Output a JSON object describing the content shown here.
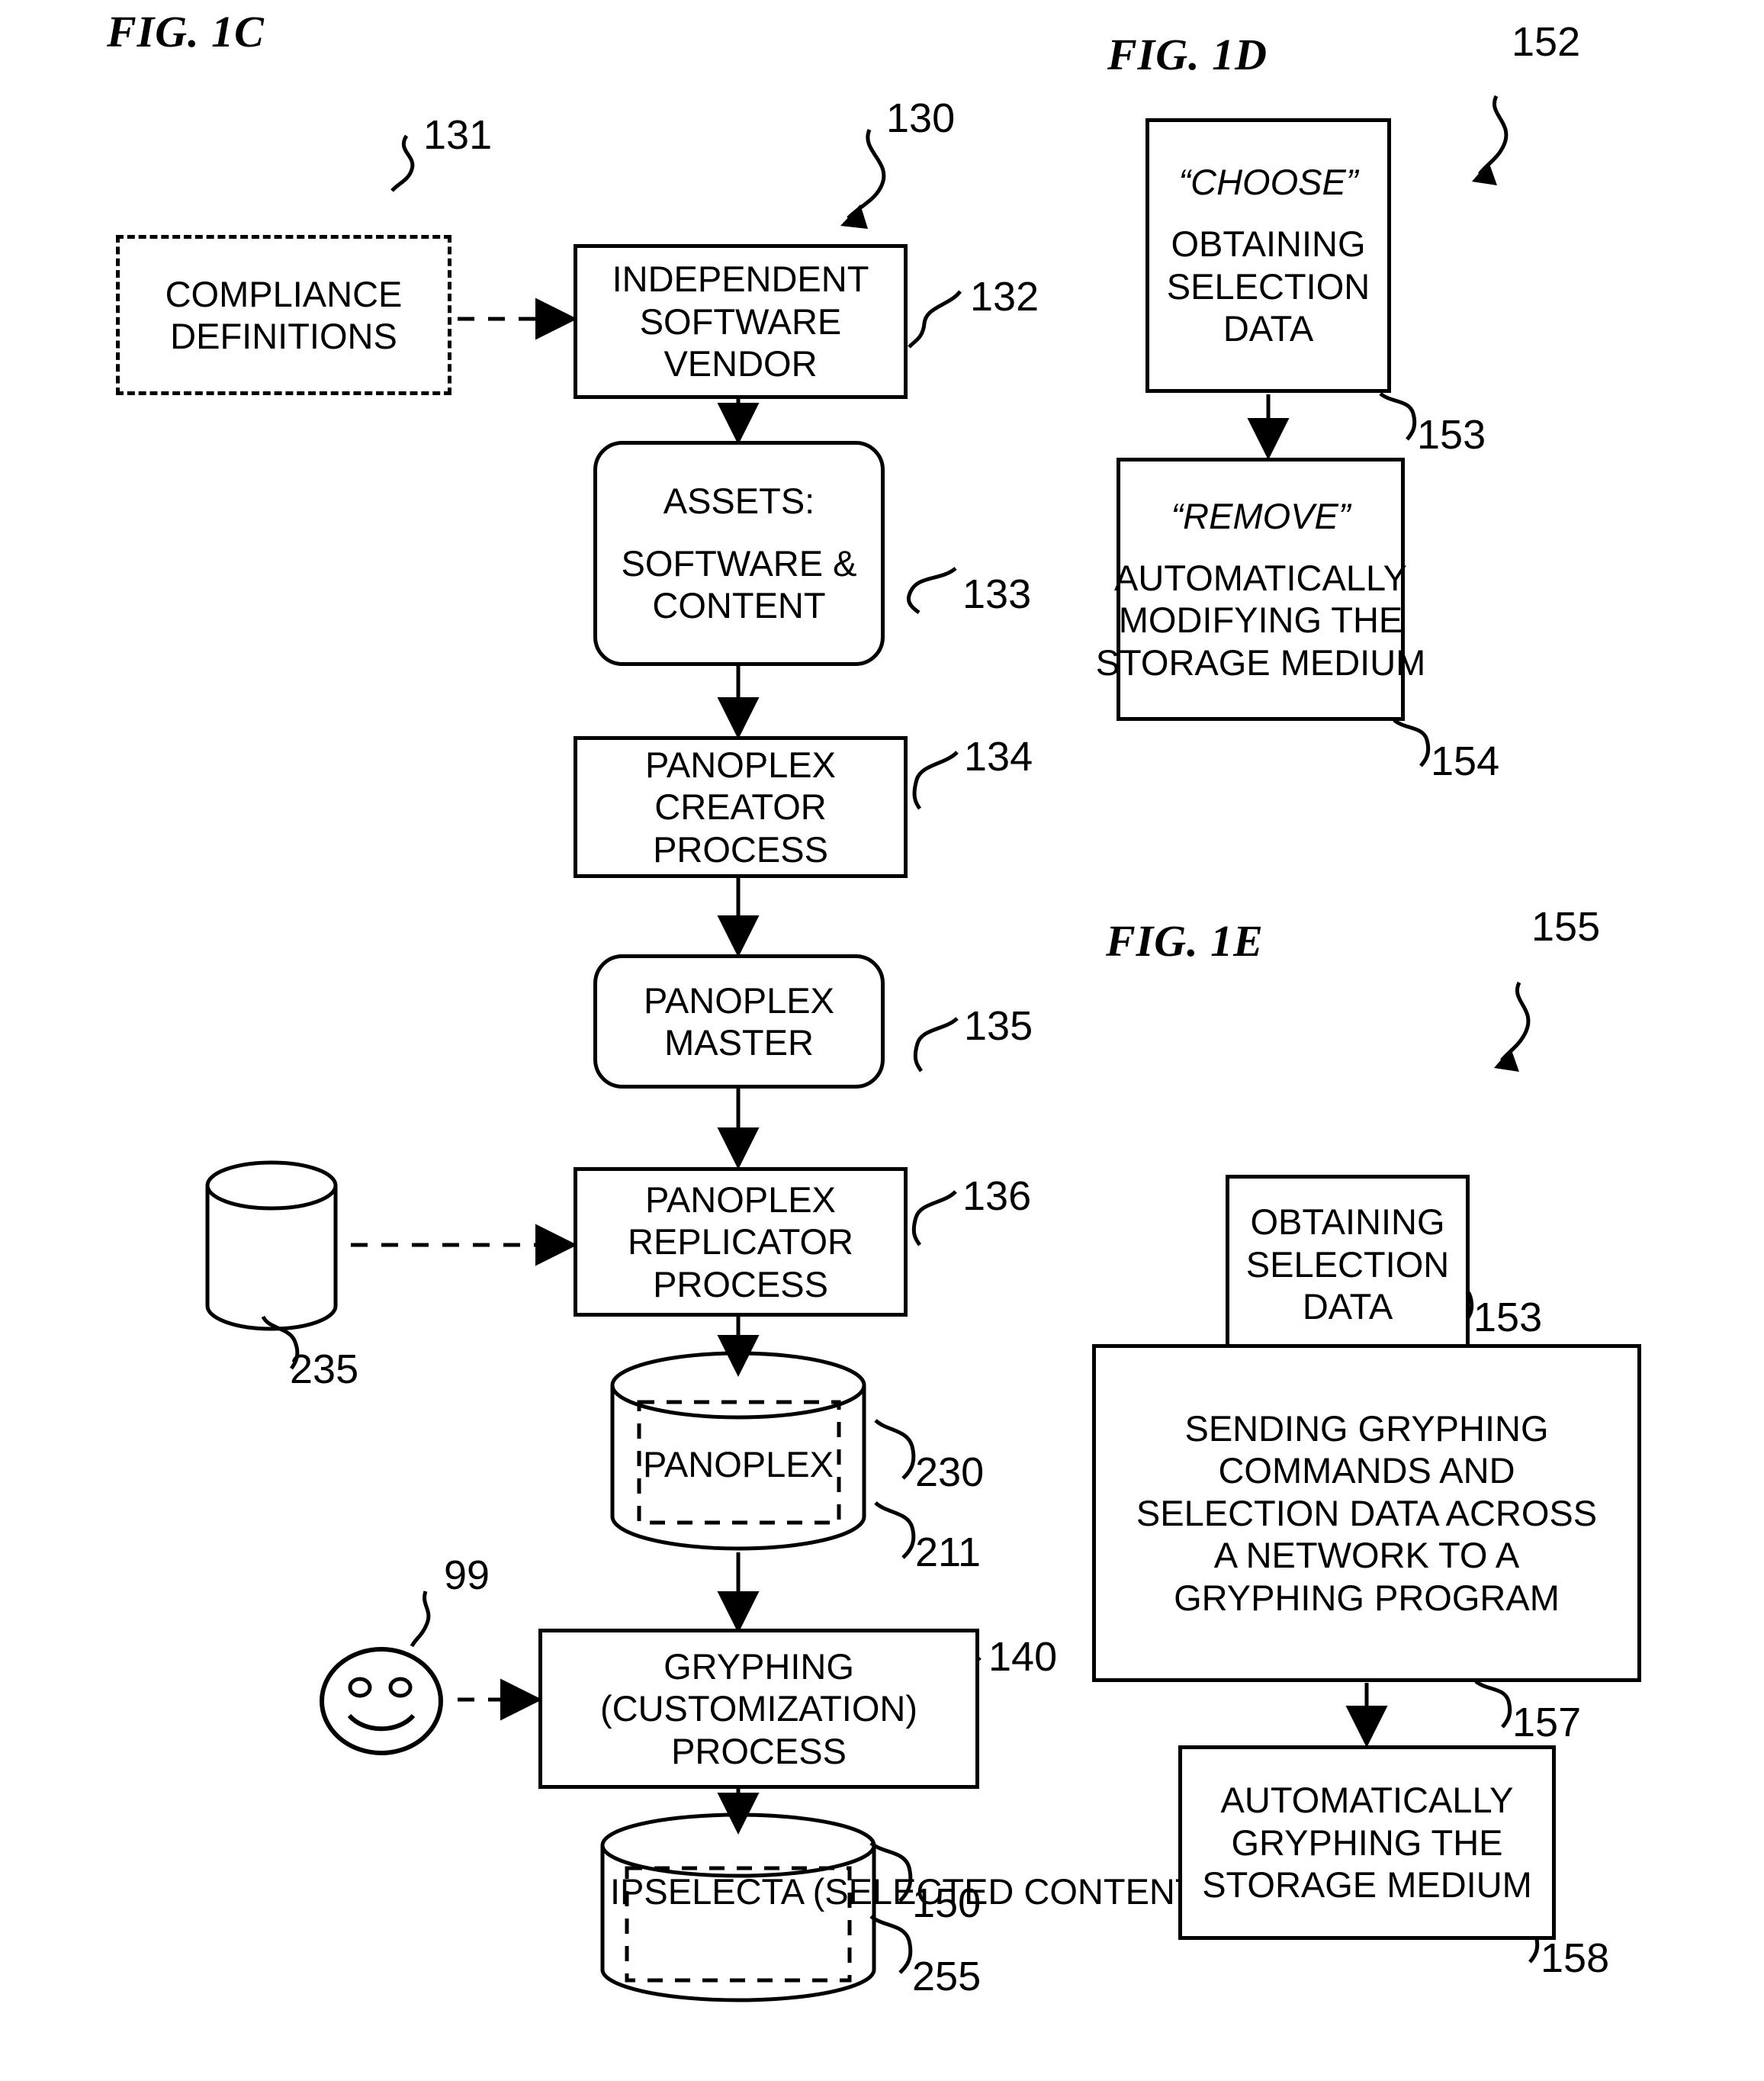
{
  "figures": {
    "fig1c": {
      "title": "FIG. 1C",
      "diagram_ref": "130",
      "nodes": {
        "compliance": {
          "lines": [
            "COMPLIANCE",
            "DEFINITIONS"
          ],
          "ref": "131",
          "shape": "dashed-rect"
        },
        "isv": {
          "lines": [
            "INDEPENDENT",
            "SOFTWARE",
            "VENDOR"
          ],
          "ref": "132",
          "shape": "rect"
        },
        "assets": {
          "lines": [
            "ASSETS:",
            "SOFTWARE &",
            "CONTENT"
          ],
          "ref": "133",
          "shape": "rounded-rect"
        },
        "creator": {
          "lines": [
            "PANOPLEX",
            "CREATOR",
            "PROCESS"
          ],
          "ref": "134",
          "shape": "rect"
        },
        "master": {
          "lines": [
            "PANOPLEX",
            "MASTER"
          ],
          "ref": "135",
          "shape": "rounded-rect"
        },
        "replicator": {
          "lines": [
            "PANOPLEX",
            "REPLICATOR",
            "PROCESS"
          ],
          "ref": "136",
          "shape": "rect"
        },
        "source_disk": {
          "lines": [],
          "ref": "235",
          "shape": "cylinder"
        },
        "panoplex_disk": {
          "lines": [
            "PANOPLEX"
          ],
          "ref": "230",
          "ref2": "211",
          "shape": "cylinder-dashed"
        },
        "user": {
          "lines": [],
          "ref": "99",
          "shape": "smiley-face"
        },
        "gryphing": {
          "lines": [
            "GRYPHING",
            "(CUSTOMIZATION)",
            "PROCESS"
          ],
          "ref": "140",
          "shape": "rect"
        },
        "ipselecta_disk": {
          "lines": [
            "IPSELECTA",
            "(SELECTED",
            "CONTENT)"
          ],
          "ref": "150",
          "ref2": "255",
          "shape": "cylinder-dashed"
        }
      }
    },
    "fig1d": {
      "title": "FIG. 1D",
      "diagram_ref": "152",
      "nodes": {
        "choose": {
          "quoted": "“CHOOSE”",
          "lines": [
            "OBTAINING",
            "SELECTION",
            "DATA"
          ],
          "ref": "153",
          "shape": "rect"
        },
        "remove": {
          "quoted": "“REMOVE”",
          "lines": [
            "AUTOMATICALLY",
            "MODIFYING THE",
            "STORAGE MEDIUM"
          ],
          "ref": "154",
          "shape": "rect"
        }
      }
    },
    "fig1e": {
      "title": "FIG. 1E",
      "diagram_ref": "155",
      "nodes": {
        "obtaining": {
          "lines": [
            "OBTAINING",
            "SELECTION",
            "DATA"
          ],
          "ref": "153",
          "shape": "rect"
        },
        "sending": {
          "lines": [
            "SENDING GRYPHING",
            "COMMANDS AND",
            "SELECTION DATA ACROSS",
            "A NETWORK TO A",
            "GRYPHING PROGRAM"
          ],
          "ref": "157",
          "shape": "rect"
        },
        "auto_gryphing": {
          "lines": [
            "AUTOMATICALLY",
            "GRYPHING THE",
            "STORAGE MEDIUM"
          ],
          "ref": "158",
          "shape": "rect"
        }
      }
    }
  },
  "colors": {
    "stroke": "#000000",
    "background": "#ffffff"
  }
}
